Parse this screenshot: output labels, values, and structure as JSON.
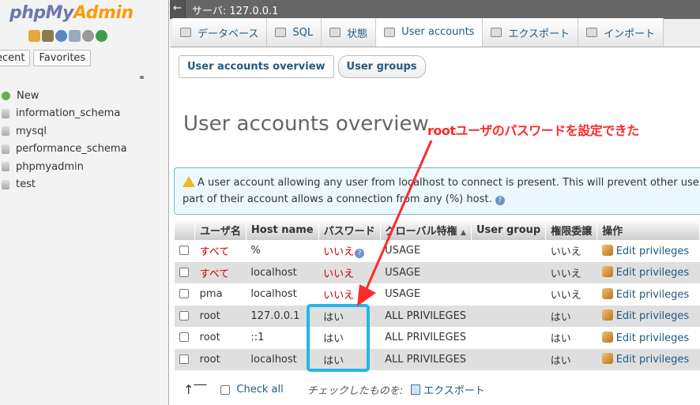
{
  "app": {
    "logo_php": "php",
    "logo_my": "My",
    "logo_admin": "Admin"
  },
  "navigation": {
    "tabs": [
      "ecent",
      "Favorites"
    ],
    "tree": [
      "New",
      "information_schema",
      "mysql",
      "performance_schema",
      "phpmyadmin",
      "test"
    ]
  },
  "server_bar": {
    "back": "←",
    "label": "サーバ: 127.0.0.1"
  },
  "tabs": [
    {
      "label": "データベース",
      "active": false
    },
    {
      "label": "SQL",
      "active": false
    },
    {
      "label": "状態",
      "active": false
    },
    {
      "label": "User accounts",
      "active": true
    },
    {
      "label": "エクスポート",
      "active": false
    },
    {
      "label": "インポート",
      "active": false
    }
  ],
  "subtabs": [
    {
      "label": "User accounts overview",
      "active": true
    },
    {
      "label": "User groups",
      "active": false
    }
  ],
  "page_title": "User accounts overview",
  "notice": {
    "line1": "A user account allowing any user from localhost to connect is present. This will prevent other use",
    "line2": "part of their account allows a connection from any (%) host."
  },
  "table": {
    "headers": [
      "",
      "ユーザ名",
      "Host name",
      "パスワード",
      "グローバル特権",
      "User group",
      "権限委譲",
      "操作"
    ],
    "sort_indicator": "▲",
    "rows": [
      {
        "user": "すべて",
        "host": "%",
        "password": "いいえ",
        "privileges": "USAGE",
        "group": "",
        "grant": "いいえ",
        "action": "Edit privileges"
      },
      {
        "user": "すべて",
        "host": "localhost",
        "password": "いいえ",
        "privileges": "USAGE",
        "group": "",
        "grant": "いいえ",
        "action": "Edit privileges"
      },
      {
        "user": "pma",
        "host": "localhost",
        "password": "いいえ",
        "privileges": "USAGE",
        "group": "",
        "grant": "いいえ",
        "action": "Edit privileges"
      },
      {
        "user": "root",
        "host": "127.0.0.1",
        "password": "はい",
        "privileges": "ALL PRIVILEGES",
        "group": "",
        "grant": "はい",
        "action": "Edit privileges"
      },
      {
        "user": "root",
        "host": "::1",
        "password": "はい",
        "privileges": "ALL PRIVILEGES",
        "group": "",
        "grant": "はい",
        "action": "Edit privileges"
      },
      {
        "user": "root",
        "host": "localhost",
        "password": "はい",
        "privileges": "ALL PRIVILEGES",
        "group": "",
        "grant": "はい",
        "action": "Edit privileges"
      }
    ]
  },
  "footer": {
    "check_all": "Check all",
    "with_selected": "チェックしたものを:",
    "export": "エクスポート"
  },
  "annotation": {
    "text": "rootユーザのパスワードを設定できた",
    "color": "#ff2a2a",
    "box_color": "#25b7e6"
  }
}
